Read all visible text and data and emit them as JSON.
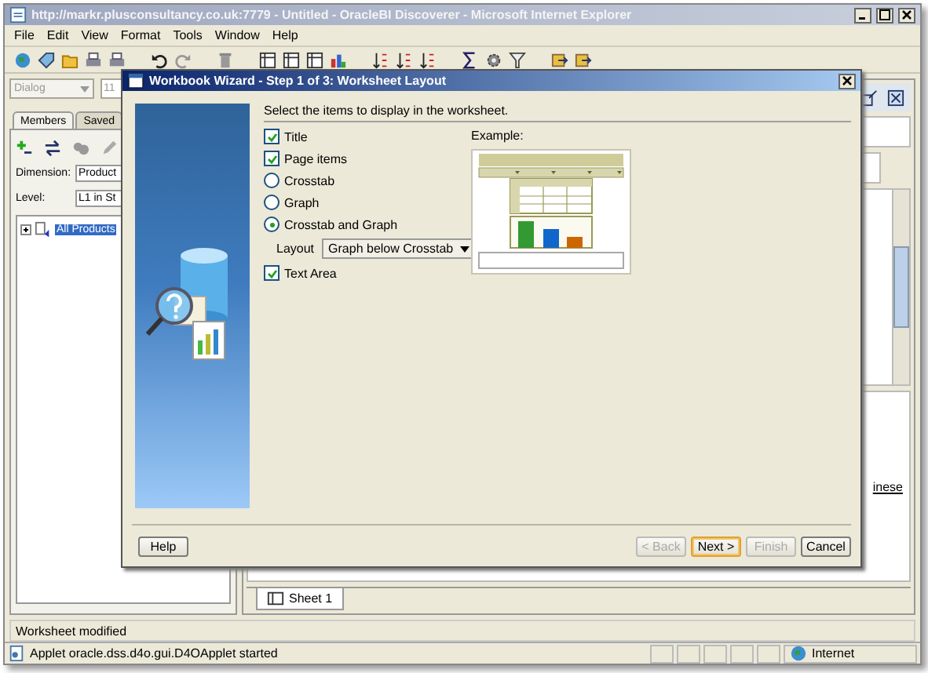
{
  "browser": {
    "title": "http://markr.plusconsultancy.co.uk:7779 - Untitled - OracleBI Discoverer - Microsoft Internet Explorer",
    "menus": [
      "File",
      "Edit",
      "View",
      "Format",
      "Tools",
      "Window",
      "Help"
    ]
  },
  "discoverer": {
    "style_box": "Dialog",
    "size_box": "11",
    "tabs": [
      {
        "label": "Members",
        "selected": true
      },
      {
        "label": "Saved",
        "selected": false
      }
    ],
    "dimension": {
      "label": "Dimension:",
      "value": "Product"
    },
    "level": {
      "label": "Level:",
      "value": "L1 in St"
    },
    "tree": [
      {
        "label": "All Products",
        "selected": true,
        "expanded": false
      }
    ],
    "link_fragment": "inese",
    "sheet_tabs": [
      {
        "label": "Sheet 1",
        "selected": true
      }
    ],
    "status": "Worksheet modified"
  },
  "dialog": {
    "title": "Workbook Wizard - Step 1 of 3: Worksheet Layout",
    "instruction": "Select the items to display in the worksheet.",
    "options": [
      {
        "kind": "checkbox",
        "label": "Title",
        "checked": true
      },
      {
        "kind": "checkbox",
        "label": "Page items",
        "checked": true
      },
      {
        "kind": "radio",
        "label": "Crosstab",
        "selected": false
      },
      {
        "kind": "radio",
        "label": "Graph",
        "selected": false
      },
      {
        "kind": "radio",
        "label": "Crosstab and Graph",
        "selected": true
      },
      {
        "kind": "dropdown",
        "label": "Layout",
        "value": "Graph below Crosstab"
      },
      {
        "kind": "checkbox",
        "label": "Text Area",
        "checked": true
      }
    ],
    "example_label": "Example:",
    "help_button": {
      "label": "Help"
    },
    "buttons": [
      {
        "label": "< Back",
        "disabled": true,
        "default": false
      },
      {
        "label": "Next >",
        "disabled": false,
        "default": true
      },
      {
        "label": "Finish",
        "disabled": true,
        "default": false
      },
      {
        "label": "Cancel",
        "disabled": false,
        "default": false
      }
    ]
  },
  "status_bar": {
    "text": "Applet oracle.dss.d4o.gui.D4OApplet started",
    "zone": "Internet"
  }
}
